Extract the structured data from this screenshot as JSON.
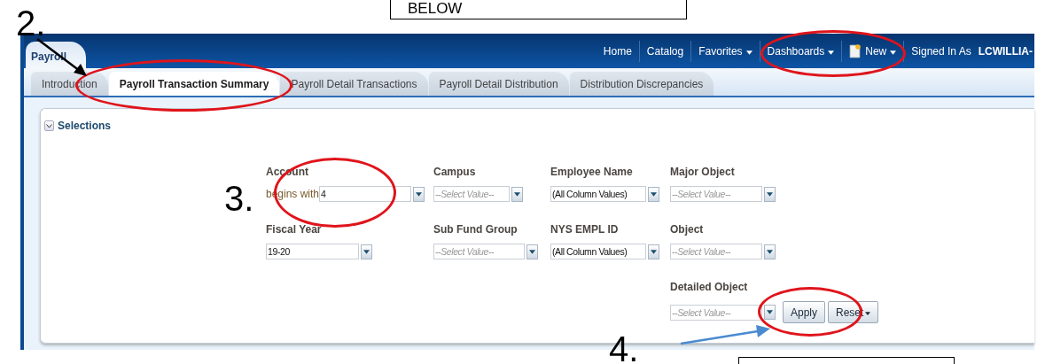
{
  "app_header": {
    "dashboard_tab": "Payroll",
    "nav_links": [
      {
        "label": "Home",
        "menu": false
      },
      {
        "label": "Catalog",
        "menu": false
      },
      {
        "label": "Favorites",
        "menu": true
      },
      {
        "label": "Dashboards",
        "menu": true
      },
      {
        "label": "New",
        "menu": true,
        "kind": "new"
      }
    ],
    "signed_in_label": "Signed In As",
    "user_name": "LCWILLIA-"
  },
  "tabs": [
    {
      "label": "Introduction",
      "selected": false
    },
    {
      "label": "Payroll Transaction Summary",
      "selected": true
    },
    {
      "label": "Payroll Detail Transactions",
      "selected": false
    },
    {
      "label": "Payroll Detail Distribution",
      "selected": false
    },
    {
      "label": "Distribution Discrepancies",
      "selected": false
    }
  ],
  "selections": {
    "title": "Selections",
    "expanded": true,
    "columns": [
      {
        "prompts": [
          {
            "label": "Account",
            "operator": "begins with",
            "value": "4"
          },
          {
            "label": "Fiscal Year",
            "value": "19-20"
          }
        ]
      },
      {
        "prompts": [
          {
            "label": "Campus",
            "placeholder": "--Select Value--"
          },
          {
            "label": "Sub Fund Group",
            "placeholder": "--Select Value--"
          }
        ]
      },
      {
        "prompts": [
          {
            "label": "Employee Name",
            "value": "(All Column Values)"
          },
          {
            "label": "NYS EMPL ID",
            "value": "(All Column Values)"
          }
        ]
      },
      {
        "prompts": [
          {
            "label": "Major Object",
            "placeholder": "--Select Value--"
          },
          {
            "label": "Object",
            "placeholder": "--Select Value--"
          },
          {
            "label": "Detailed Object",
            "placeholder": "--Select Value--"
          }
        ]
      }
    ],
    "buttons": [
      {
        "label": "Apply",
        "menu": false
      },
      {
        "label": "Reset",
        "menu": true
      }
    ]
  },
  "annotations": {
    "steps": [
      "2.",
      "3.",
      "4."
    ],
    "callout": "BELOW"
  }
}
